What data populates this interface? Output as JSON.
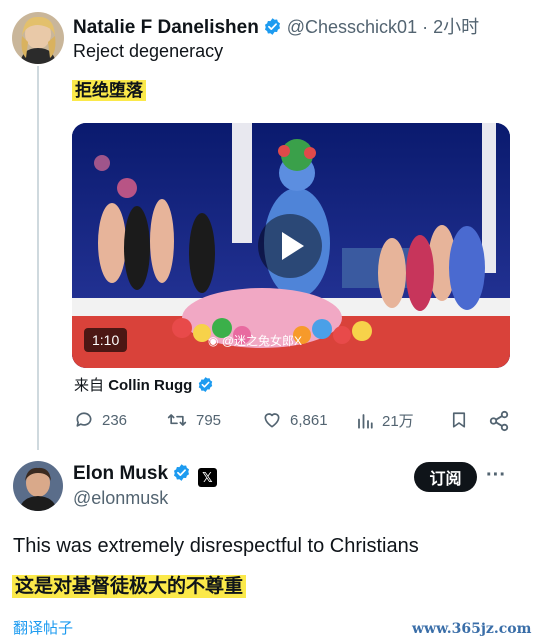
{
  "tweet1": {
    "author_name": "Natalie F Danelishen",
    "handle_time": "@Chesschick01 · 2小时",
    "text_en": "Reject degeneracy",
    "text_cn": "拒绝堕落",
    "video": {
      "duration": "1:10",
      "watermark": "@迷之兔女郎X"
    },
    "source_prefix": "来自",
    "source_name": "Collin Rugg",
    "stats": {
      "replies": "236",
      "retweets": "795",
      "likes": "6,861",
      "views": "21万"
    }
  },
  "tweet2": {
    "author_name": "Elon Musk",
    "handle": "@elonmusk",
    "subscribe_label": "订阅",
    "more_label": "···",
    "text_en": "This was extremely disrespectful to Christians",
    "text_cn": "这是对基督徒极大的不尊重",
    "translate_label": "翻译帖子"
  },
  "site_watermark": "www.365jz.com",
  "colors": {
    "verified_blue": "#1d9bf0",
    "highlight": "#fbe94a",
    "muted": "#536471",
    "link": "#1d9bf0"
  }
}
